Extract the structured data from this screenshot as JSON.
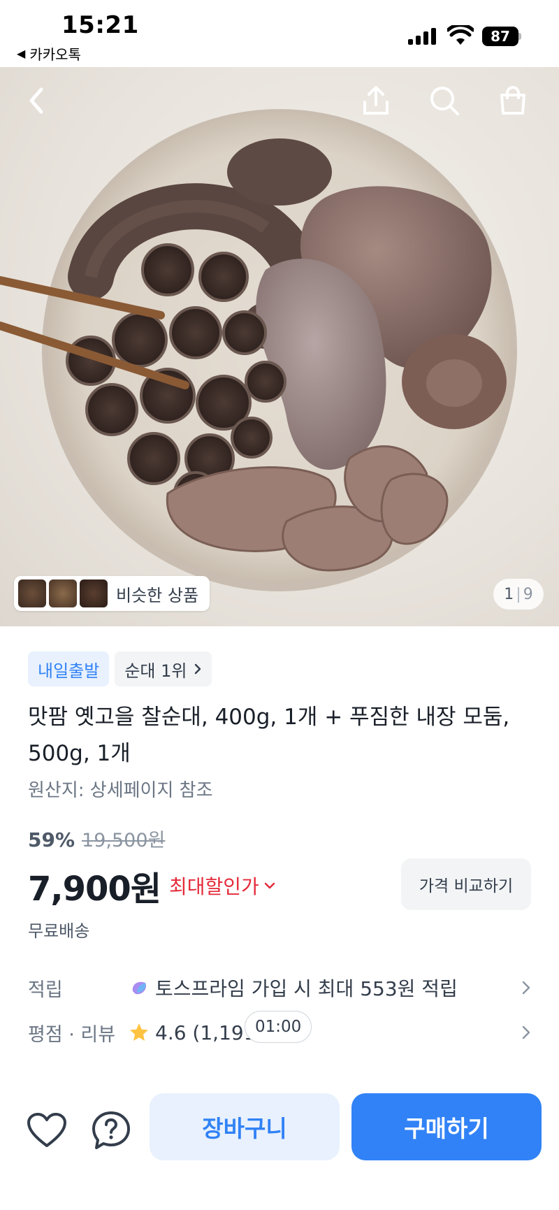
{
  "status_bar": {
    "time": "15:21",
    "back_app": "카카오톡",
    "battery": "87"
  },
  "hero": {
    "similar_label": "비슷한 상품",
    "page_current": "1",
    "page_total": "9"
  },
  "product": {
    "badge_delivery": "내일출발",
    "badge_rank": "순대 1위",
    "title": "맛팜 옛고을 찰순대, 400g, 1개 + 푸짐한 내장 모둠, 500g, 1개",
    "origin": "원산지: 상세페이지 참조",
    "discount_pct": "59%",
    "original_price": "19,500원",
    "price": "7,900원",
    "max_discount_label": "최대할인가",
    "compare_label": "가격 비교하기",
    "shipping": "무료배송"
  },
  "info": {
    "points_label": "적립",
    "points_value": "토스프라임 가입 시 최대 553원 적립",
    "rating_label": "평점 · 리뷰",
    "rating_value": "4.6 (1,191)",
    "timer": "01:00"
  },
  "bottom_bar": {
    "cart_label": "장바구니",
    "buy_label": "구매하기"
  },
  "colors": {
    "accent_blue": "#3182f6",
    "discount_red": "#e42939",
    "star_yellow": "#ffc342"
  }
}
